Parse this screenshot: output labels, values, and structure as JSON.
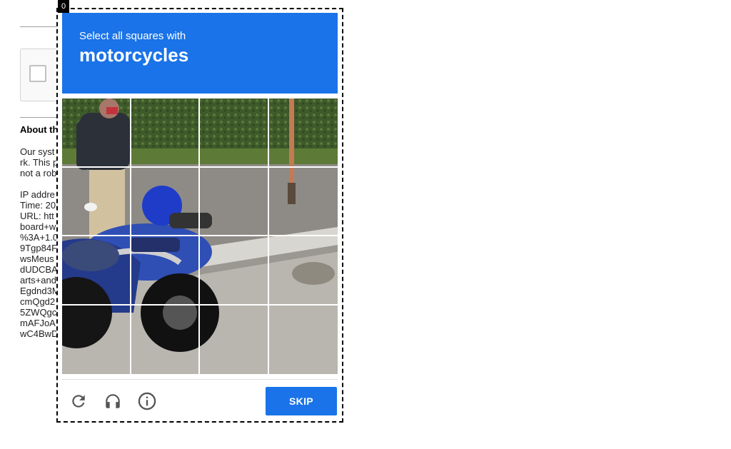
{
  "focus_badge": "0",
  "challenge": {
    "instruction": "Select all squares with",
    "target": "motorcycles",
    "skip_label": "SKIP"
  },
  "icons": {
    "reload": "reload-icon",
    "audio": "headphones-icon",
    "info": "info-icon"
  },
  "background_page": {
    "about_heading": "About th",
    "lines": [
      "Our syst",
      "rk. This p",
      "not a rob",
      "",
      "IP addre",
      "Time: 20",
      "URL: htt",
      "board+w",
      "%3A+1.0",
      "9Tgp84F",
      "wsMeus",
      "dUDCBA",
      "arts+and",
      "Egdnd3M",
      "cmQgd2",
      "5ZWQgc",
      "mAFJoA",
      "wC4BwD"
    ]
  },
  "colors": {
    "accent": "#1a73e8",
    "header_text": "#ffffff"
  }
}
